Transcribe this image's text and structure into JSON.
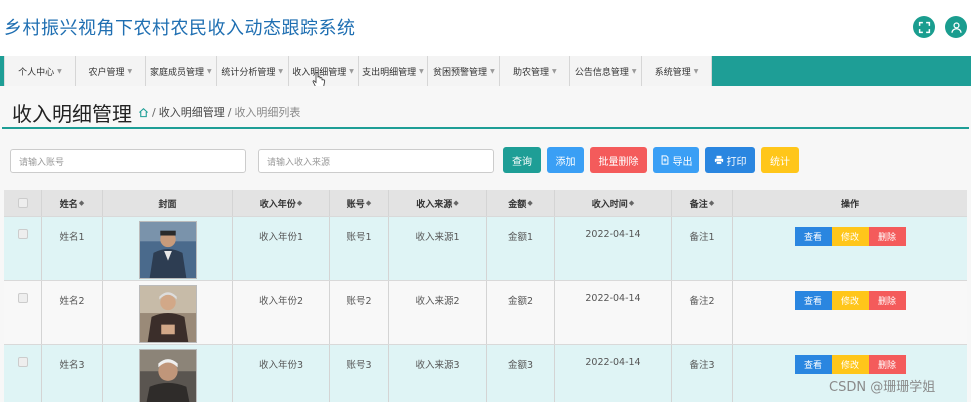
{
  "app": {
    "title": "乡村振兴视角下农村农民收入动态跟踪系统"
  },
  "header_icons": [
    {
      "name": "fullscreen-icon",
      "color": "#1a9d8f"
    },
    {
      "name": "user-icon",
      "color": "#1a9d8f"
    }
  ],
  "nav": {
    "items": [
      {
        "label": "个人中心"
      },
      {
        "label": "农户管理"
      },
      {
        "label": "家庭成员管理"
      },
      {
        "label": "统计分析管理"
      },
      {
        "label": "收入明细管理"
      },
      {
        "label": "支出明细管理"
      },
      {
        "label": "贫困预警管理"
      },
      {
        "label": "助农管理"
      },
      {
        "label": "公告信息管理"
      },
      {
        "label": "系统管理"
      }
    ]
  },
  "page": {
    "title": "收入明细管理",
    "breadcrumb": {
      "current": "收入明细管理",
      "sub": "收入明细列表"
    }
  },
  "search": {
    "account_placeholder": "请输入账号",
    "source_placeholder": "请输入收入来源"
  },
  "buttons": {
    "query": "查询",
    "add": "添加",
    "batch_delete": "批量删除",
    "export": "导出",
    "print": "打印",
    "stats": "统计"
  },
  "table": {
    "headers": {
      "name": "姓名",
      "cover": "封面",
      "year": "收入年份",
      "account": "账号",
      "source": "收入来源",
      "amount": "金额",
      "time": "收入时间",
      "note": "备注",
      "action": "操作"
    },
    "rows": [
      {
        "name": "姓名1",
        "year": "收入年份1",
        "account": "账号1",
        "source": "收入来源1",
        "amount": "金额1",
        "time": "2022-04-14",
        "note": "备注1"
      },
      {
        "name": "姓名2",
        "year": "收入年份2",
        "account": "账号2",
        "source": "收入来源2",
        "amount": "金额2",
        "time": "2022-04-14",
        "note": "备注2"
      },
      {
        "name": "姓名3",
        "year": "收入年份3",
        "account": "账号3",
        "source": "收入来源3",
        "amount": "金额3",
        "time": "2022-04-14",
        "note": "备注3"
      }
    ],
    "row_actions": {
      "view": "查看",
      "edit": "修改",
      "delete": "删除"
    }
  },
  "watermark": "CSDN @珊珊学姐",
  "colors": {
    "theme": "#1e9e96",
    "title": "#1f6fb2",
    "query": "#1e9e96",
    "add": "#3a9ff5",
    "batch_delete": "#f45b5b",
    "export": "#3a9ff5",
    "print": "#2a86e0",
    "stats": "#ffc61a",
    "view": "#2a86e0",
    "edit": "#ffc61a",
    "delete": "#f45b5b"
  }
}
